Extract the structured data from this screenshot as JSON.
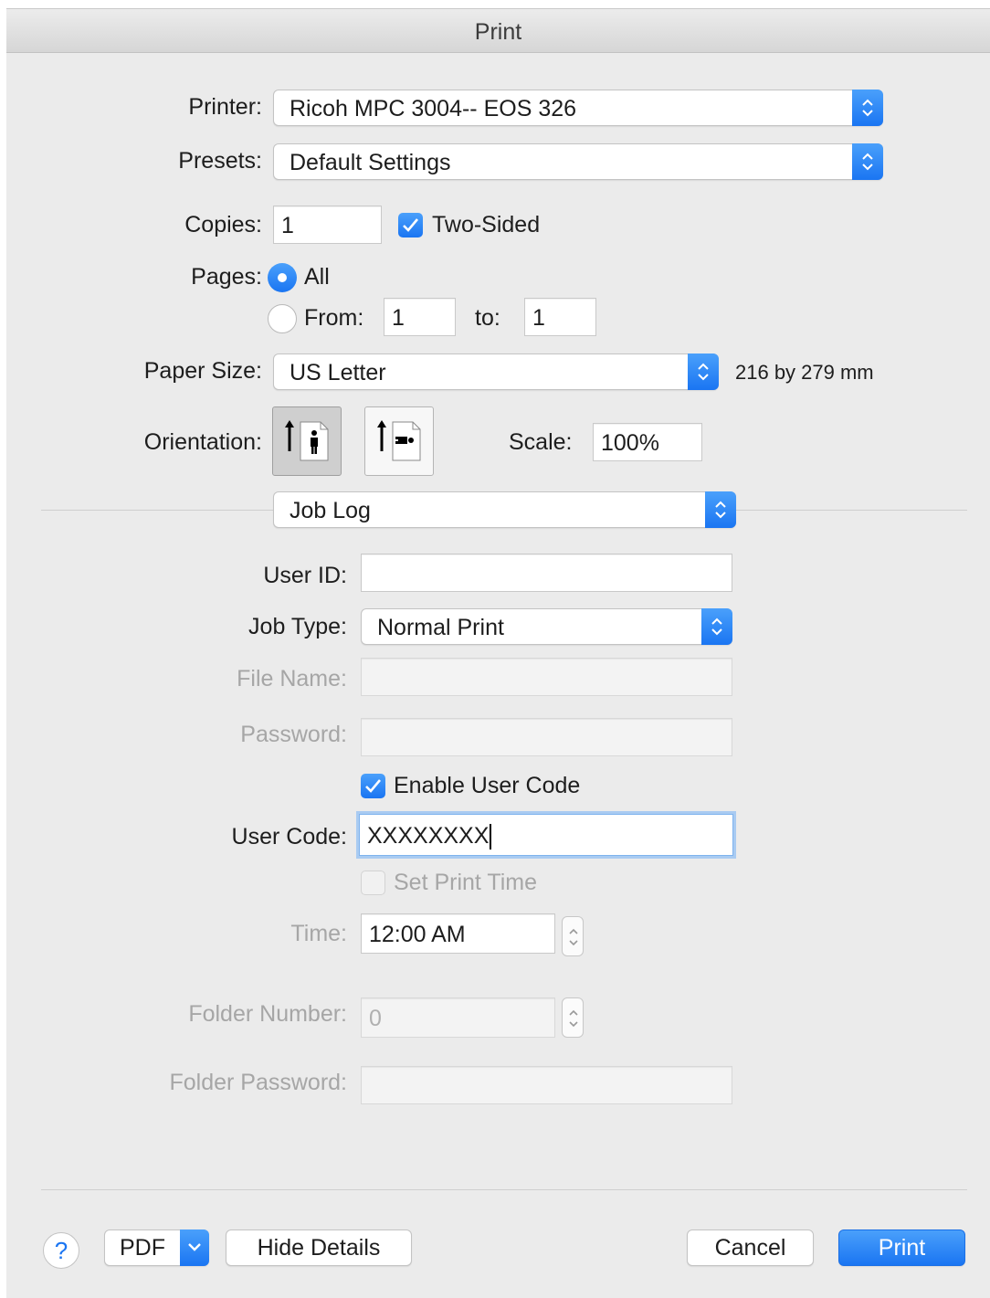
{
  "window": {
    "title": "Print"
  },
  "printer": {
    "label": "Printer:",
    "value": "Ricoh MPC 3004-- EOS 326"
  },
  "presets": {
    "label": "Presets:",
    "value": "Default Settings"
  },
  "copies": {
    "label": "Copies:",
    "value": "1",
    "two_sided_label": "Two-Sided",
    "two_sided": true
  },
  "pages": {
    "label": "Pages:",
    "all_label": "All",
    "from_label": "From:",
    "from_value": "1",
    "to_label": "to:",
    "to_value": "1",
    "selected": "All"
  },
  "paper_size": {
    "label": "Paper Size:",
    "value": "US Letter",
    "dimensions": "216 by 279 mm"
  },
  "orientation": {
    "label": "Orientation:",
    "selected": "portrait"
  },
  "scale": {
    "label": "Scale:",
    "value": "100%"
  },
  "section": {
    "value": "Job Log"
  },
  "job_log": {
    "user_id_label": "User ID:",
    "user_id_value": "",
    "job_type_label": "Job Type:",
    "job_type_value": "Normal Print",
    "file_name_label": "File Name:",
    "file_name_value": "",
    "password_label": "Password:",
    "password_value": "",
    "enable_user_code_label": "Enable User Code",
    "enable_user_code": true,
    "user_code_label": "User Code:",
    "user_code_value": "XXXXXXXX",
    "set_print_time_label": "Set Print Time",
    "set_print_time": false,
    "time_label": "Time:",
    "time_value": "12:00 AM",
    "folder_number_label": "Folder Number:",
    "folder_number_value": "0",
    "folder_password_label": "Folder Password:",
    "folder_password_value": ""
  },
  "footer": {
    "help_label": "?",
    "pdf_label": "PDF",
    "hide_details_label": "Hide Details",
    "cancel_label": "Cancel",
    "print_label": "Print"
  },
  "colors": {
    "accent": "#1a75f2",
    "window_bg": "#ebebeb",
    "disabled_text": "#a6a6a6"
  }
}
